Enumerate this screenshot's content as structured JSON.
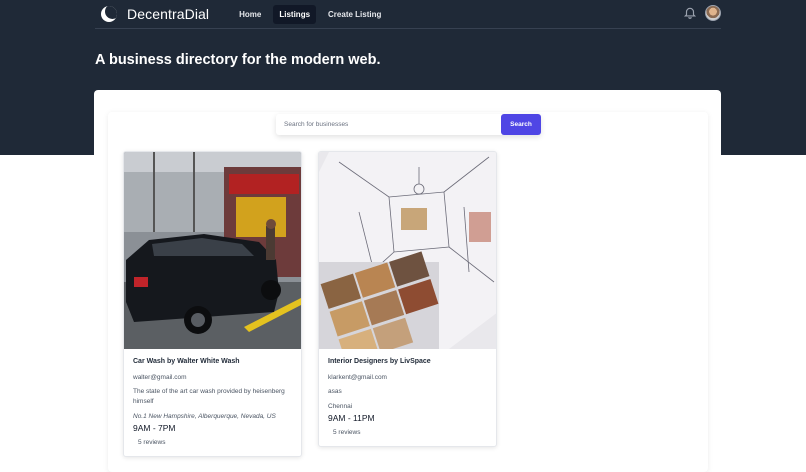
{
  "app": {
    "brand": "DecentraDial",
    "nav": [
      {
        "label": "Home",
        "active": false
      },
      {
        "label": "Listings",
        "active": true
      },
      {
        "label": "Create Listing",
        "active": false
      }
    ]
  },
  "hero": {
    "title": "A business directory for the modern web."
  },
  "search": {
    "placeholder": "Search for businesses",
    "button_label": "Search",
    "accent": "#4f46e5"
  },
  "listings": [
    {
      "title": "Car Wash by Walter White Wash",
      "email": "walter@gmail.com",
      "description": "The state of the art car wash provided by heisenberg himself",
      "address": "No.1 New Hampshire, Alberquerque, Nevada, US",
      "hours": "9AM - 7PM",
      "reviews": "5 reviews",
      "image": "car-wash-photo"
    },
    {
      "title": "Interior Designers by LivSpace",
      "email": "klarkent@gmail.com",
      "description": "asas",
      "address": "Chennai",
      "hours": "9AM - 11PM",
      "reviews": "5 reviews",
      "image": "interior-sketch-photo"
    }
  ],
  "colors": {
    "header_bg": "#1f2937",
    "primary": "#4f46e5"
  }
}
